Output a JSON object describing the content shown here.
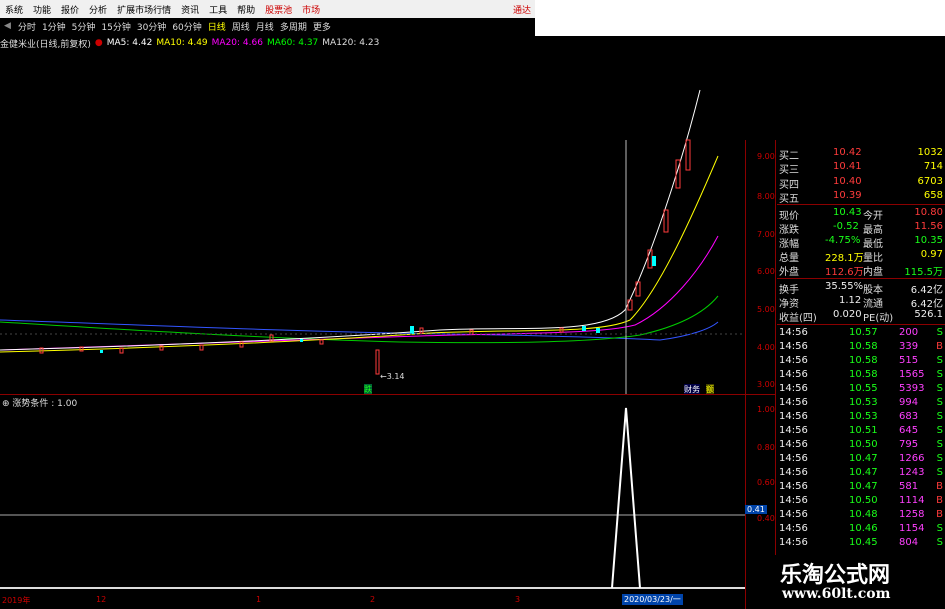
{
  "menu": {
    "items": [
      "系统",
      "功能",
      "报价",
      "分析",
      "扩展市场行情",
      "资讯",
      "工具",
      "帮助"
    ],
    "hot_items": [
      "股票池",
      "市场"
    ],
    "right_label": "通达"
  },
  "periods": {
    "items": [
      "分时",
      "1分钟",
      "5分钟",
      "15分钟",
      "30分钟",
      "60分钟",
      "日线",
      "周线",
      "月线",
      "多周期",
      "更多"
    ],
    "selected": "日线"
  },
  "ma_header": {
    "stock": "金健米业(日线,前复权)",
    "ma5": "MA5: 4.42",
    "ma10": "MA10: 4.49",
    "ma20": "MA20: 4.66",
    "ma60": "MA60: 4.37",
    "ma120": "MA120: 4.23"
  },
  "price_axis": [
    "9.00",
    "8.00",
    "7.00",
    "6.00",
    "5.00",
    "4.00",
    "3.00"
  ],
  "low_label": "3.14",
  "markers": {
    "m1": "跌",
    "m2": "财务",
    "m3": "额"
  },
  "indicator": {
    "title": "涨势条件 : 1.00",
    "axis": [
      "1.00",
      "0.80",
      "0.60",
      "0.40",
      "0.20"
    ],
    "current_value": "0.41"
  },
  "date_axis": {
    "labels": [
      "2019年",
      "12",
      "1",
      "2",
      "3"
    ],
    "cursor_date": "2020/03/23/一"
  },
  "quote": {
    "bids": [
      {
        "label": "买二",
        "price": "10.42",
        "vol": "1032"
      },
      {
        "label": "买三",
        "price": "10.41",
        "vol": "714"
      },
      {
        "label": "买四",
        "price": "10.40",
        "vol": "6703"
      },
      {
        "label": "买五",
        "price": "10.39",
        "vol": "658"
      }
    ],
    "stats": [
      {
        "l1": "现价",
        "v1": "10.43",
        "l2": "今开",
        "v2": "10.80"
      },
      {
        "l1": "涨跌",
        "v1": "-0.52",
        "l2": "最高",
        "v2": "11.56"
      },
      {
        "l1": "涨幅",
        "v1": "-4.75%",
        "l2": "最低",
        "v2": "10.35"
      },
      {
        "l1": "总量",
        "v1": "228.1万",
        "l2": "量比",
        "v2": "0.97"
      },
      {
        "l1": "外盘",
        "v1": "112.6万",
        "l2": "内盘",
        "v2": "115.5万"
      }
    ],
    "stats2": [
      {
        "l1": "换手",
        "v1": "35.55%",
        "l2": "股本",
        "v2": "6.42亿"
      },
      {
        "l1": "净资",
        "v1": "1.12",
        "l2": "流通",
        "v2": "6.42亿"
      },
      {
        "l1": "收益(四)",
        "v1": "0.020",
        "l2": "PE(动)",
        "v2": "526.1"
      }
    ],
    "ticks": [
      {
        "t": "14:56",
        "p": "10.57",
        "v": "200",
        "s": "S"
      },
      {
        "t": "14:56",
        "p": "10.58",
        "v": "339",
        "s": "B"
      },
      {
        "t": "14:56",
        "p": "10.58",
        "v": "515",
        "s": "S"
      },
      {
        "t": "14:56",
        "p": "10.58",
        "v": "1565",
        "s": "S"
      },
      {
        "t": "14:56",
        "p": "10.55",
        "v": "5393",
        "s": "S"
      },
      {
        "t": "14:56",
        "p": "10.53",
        "v": "994",
        "s": "S"
      },
      {
        "t": "14:56",
        "p": "10.53",
        "v": "683",
        "s": "S"
      },
      {
        "t": "14:56",
        "p": "10.51",
        "v": "645",
        "s": "S"
      },
      {
        "t": "14:56",
        "p": "10.50",
        "v": "795",
        "s": "S"
      },
      {
        "t": "14:56",
        "p": "10.47",
        "v": "1266",
        "s": "S"
      },
      {
        "t": "14:56",
        "p": "10.47",
        "v": "1243",
        "s": "S"
      },
      {
        "t": "14:56",
        "p": "10.47",
        "v": "581",
        "s": "B"
      },
      {
        "t": "14:56",
        "p": "10.50",
        "v": "1114",
        "s": "B"
      },
      {
        "t": "14:56",
        "p": "10.48",
        "v": "1258",
        "s": "B"
      },
      {
        "t": "14:56",
        "p": "10.46",
        "v": "1154",
        "s": "S"
      },
      {
        "t": "14:56",
        "p": "10.45",
        "v": "804",
        "s": "S"
      }
    ]
  },
  "watermark": {
    "line1": "乐淘公式网",
    "line2": "www.60lt.com"
  },
  "colors": {
    "up": "#ff3b3b",
    "down": "#19ff19",
    "axis": "#c00000",
    "ma5": "#ffffff",
    "ma10": "#ffff00",
    "ma20": "#ff00ff",
    "ma60": "#00ff00",
    "ma120": "#3355ff"
  }
}
